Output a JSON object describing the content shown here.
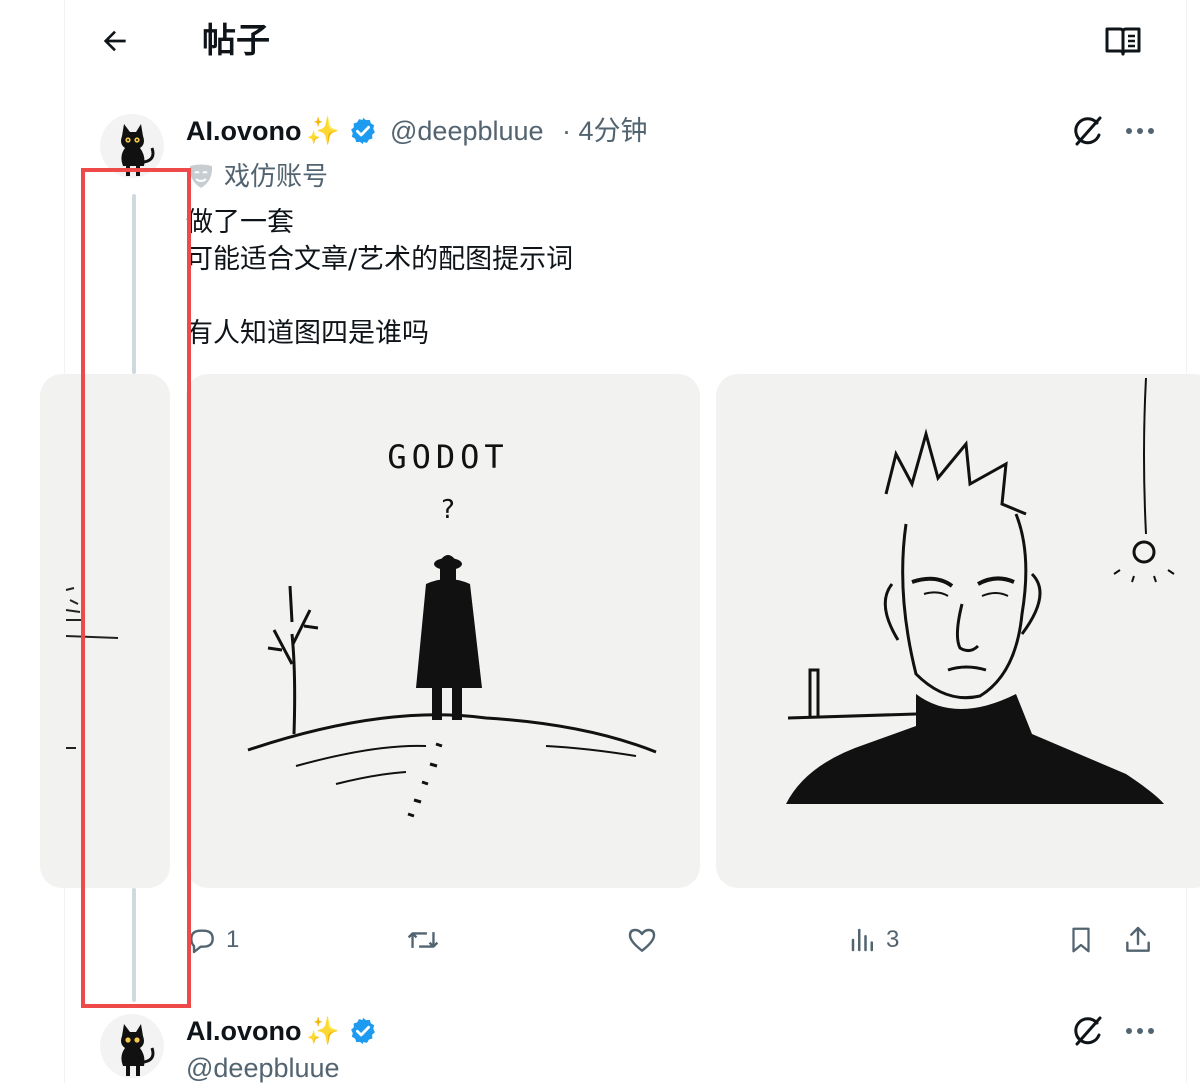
{
  "header": {
    "title": "帖子",
    "back_icon": "arrow-left-icon",
    "reader_icon": "reader-mode-icon"
  },
  "tweet": {
    "display_name": "AI.ovono",
    "name_emoji": "✨",
    "handle": "@deepbluue",
    "time": "· 4分钟",
    "parody_label": "戏仿账号",
    "text": "做了一套\n可能适合文章/艺术的配图提示词\n\n有人知道图四是谁吗",
    "images": [
      {
        "caption": "GODOT"
      },
      {
        "caption": "?"
      }
    ],
    "actions": {
      "replies": "1",
      "reposts": "",
      "likes": "",
      "views": "3"
    }
  },
  "reply_preview": {
    "display_name": "AI.ovono",
    "name_emoji": "✨",
    "handle": "@deepbluue"
  },
  "colors": {
    "verified": "#1d9bf0",
    "muted": "#536471",
    "thread_line": "#cfd9de",
    "highlight": "#ef4a4a"
  }
}
